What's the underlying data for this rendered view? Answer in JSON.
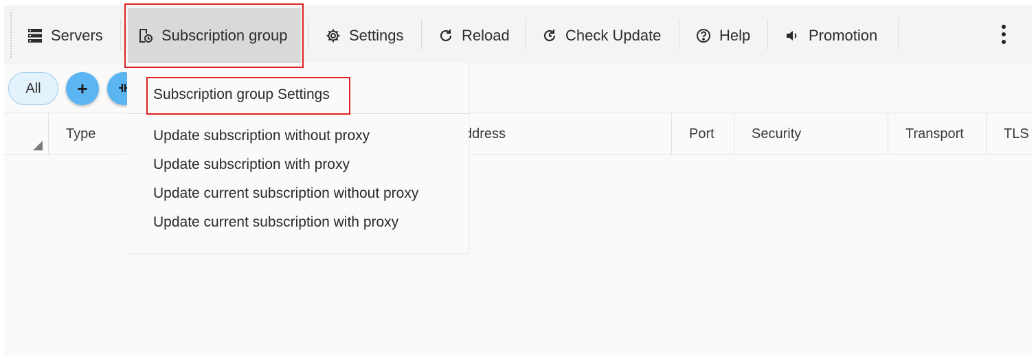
{
  "toolbar": {
    "items": [
      {
        "label": "Servers",
        "icon": "server-icon"
      },
      {
        "label": "Subscription group",
        "icon": "subscription-icon"
      },
      {
        "label": "Settings",
        "icon": "gear-icon"
      },
      {
        "label": "Reload",
        "icon": "reload-icon"
      },
      {
        "label": "Check Update",
        "icon": "check-update-icon"
      },
      {
        "label": "Help",
        "icon": "help-icon"
      },
      {
        "label": "Promotion",
        "icon": "speaker-icon"
      }
    ],
    "more_icon": "more-vertical-icon"
  },
  "filter": {
    "all_label": "All",
    "add_label": "+",
    "third_button_icon": "split-icon"
  },
  "grid": {
    "columns": [
      "Type",
      "ddress",
      "Port",
      "Security",
      "Transport",
      "TLS"
    ]
  },
  "menu": {
    "items": [
      "Subscription group Settings",
      "Update subscription without proxy",
      "Update subscription with proxy",
      "Update current subscription without proxy",
      "Update current subscription with proxy"
    ]
  },
  "colors": {
    "accent": "#5bb5f3",
    "highlight": "#e02020",
    "active_bg": "#d9d9d9"
  }
}
